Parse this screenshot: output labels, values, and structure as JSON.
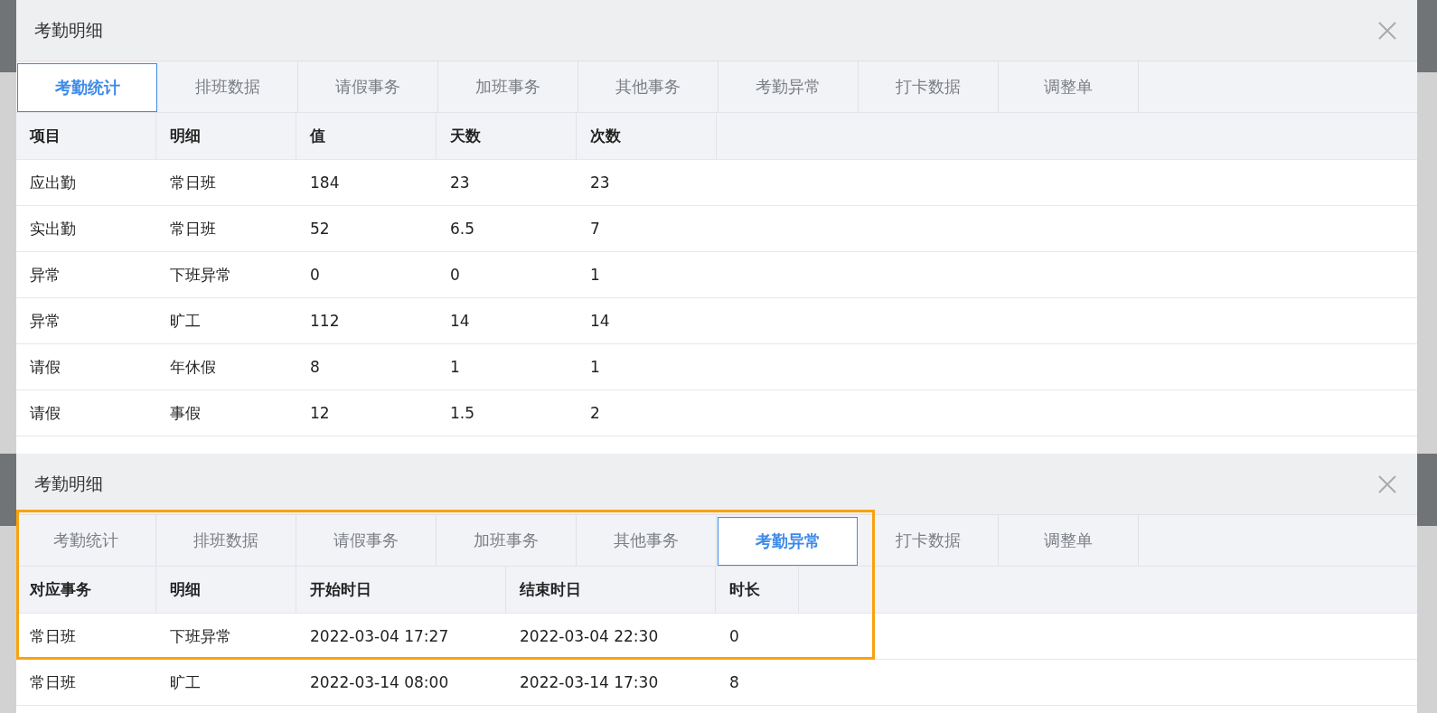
{
  "panels": [
    {
      "title": "考勤明细",
      "highlighted": false,
      "tabs": [
        {
          "label": "考勤统计",
          "selected": true
        },
        {
          "label": "排班数据",
          "selected": false
        },
        {
          "label": "请假事务",
          "selected": false
        },
        {
          "label": "加班事务",
          "selected": false
        },
        {
          "label": "其他事务",
          "selected": false
        },
        {
          "label": "考勤异常",
          "selected": false
        },
        {
          "label": "打卡数据",
          "selected": false
        },
        {
          "label": "调整单",
          "selected": false
        }
      ],
      "columns": [
        "项目",
        "明细",
        "值",
        "天数",
        "次数"
      ],
      "rows": [
        [
          "应出勤",
          "常日班",
          "184",
          "23",
          "23"
        ],
        [
          "实出勤",
          "常日班",
          "52",
          "6.5",
          "7"
        ],
        [
          "异常",
          "下班异常",
          "0",
          "0",
          "1"
        ],
        [
          "异常",
          "旷工",
          "112",
          "14",
          "14"
        ],
        [
          "请假",
          "年休假",
          "8",
          "1",
          "1"
        ],
        [
          "请假",
          "事假",
          "12",
          "1.5",
          "2"
        ]
      ]
    },
    {
      "title": "考勤明细",
      "highlighted": true,
      "tabs": [
        {
          "label": "考勤统计",
          "selected": false
        },
        {
          "label": "排班数据",
          "selected": false
        },
        {
          "label": "请假事务",
          "selected": false
        },
        {
          "label": "加班事务",
          "selected": false
        },
        {
          "label": "其他事务",
          "selected": false
        },
        {
          "label": "考勤异常",
          "selected": true
        },
        {
          "label": "打卡数据",
          "selected": false
        },
        {
          "label": "调整单",
          "selected": false
        }
      ],
      "columns": [
        "对应事务",
        "明细",
        "开始时日",
        "结束时日",
        "时长"
      ],
      "rows": [
        [
          "常日班",
          "下班异常",
          "2022-03-04 17:27",
          "2022-03-04 22:30",
          "0"
        ],
        [
          "常日班",
          "旷工",
          "2022-03-14 08:00",
          "2022-03-14 17:30",
          "8"
        ]
      ]
    }
  ]
}
